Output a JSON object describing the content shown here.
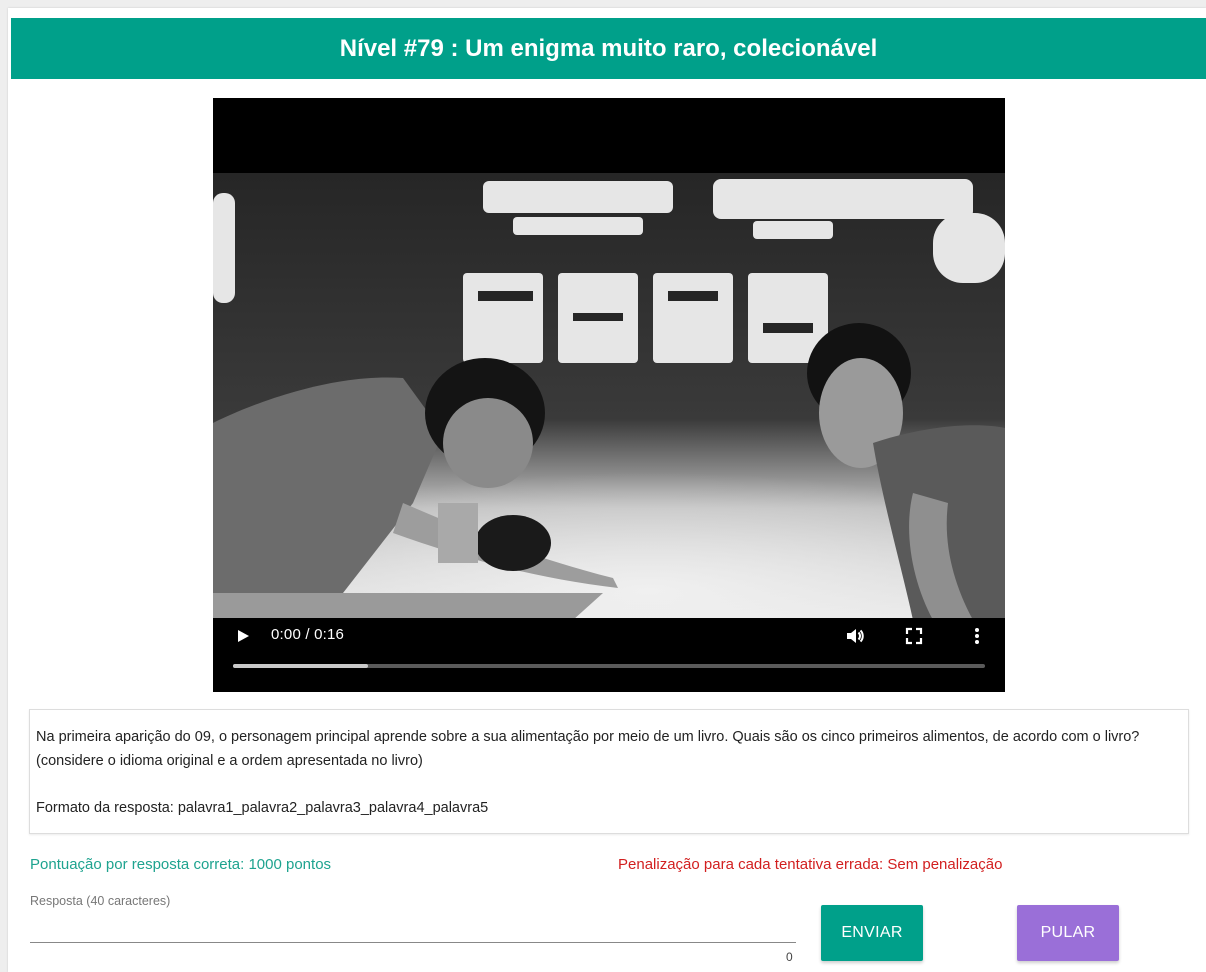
{
  "colors": {
    "title_bg": "#00a08a",
    "send_button": "#00a08a",
    "skip_button": "#9a6fd8",
    "score_text": "#1ea38f",
    "penalty_text": "#d21f1f"
  },
  "header": {
    "title": "Nível #79 : Um enigma muito raro, colecionável"
  },
  "video": {
    "time_display": "0:00 / 0:16",
    "progress_fraction": 0.18,
    "controls": [
      "play-icon",
      "volume-icon",
      "fullscreen-icon",
      "more-options-icon"
    ]
  },
  "question": {
    "text": "Na primeira aparição do 09, o personagem principal aprende sobre a sua alimentação por meio de um livro. Quais são os cinco primeiros alimentos, de acordo com o livro? (considere o idioma original e a ordem apresentada no livro)",
    "answer_format": "Formato da resposta: palavra1_palavra2_palavra3_palavra4_palavra5"
  },
  "scoring": {
    "points": "Pontuação por resposta correta: 1000 pontos",
    "penalty": "Penalização para cada tentativa errada: Sem penalização"
  },
  "answer": {
    "label": "Resposta (40 caracteres)",
    "value": "",
    "char_count": "0"
  },
  "buttons": {
    "send": "ENVIAR",
    "skip": "PULAR"
  }
}
